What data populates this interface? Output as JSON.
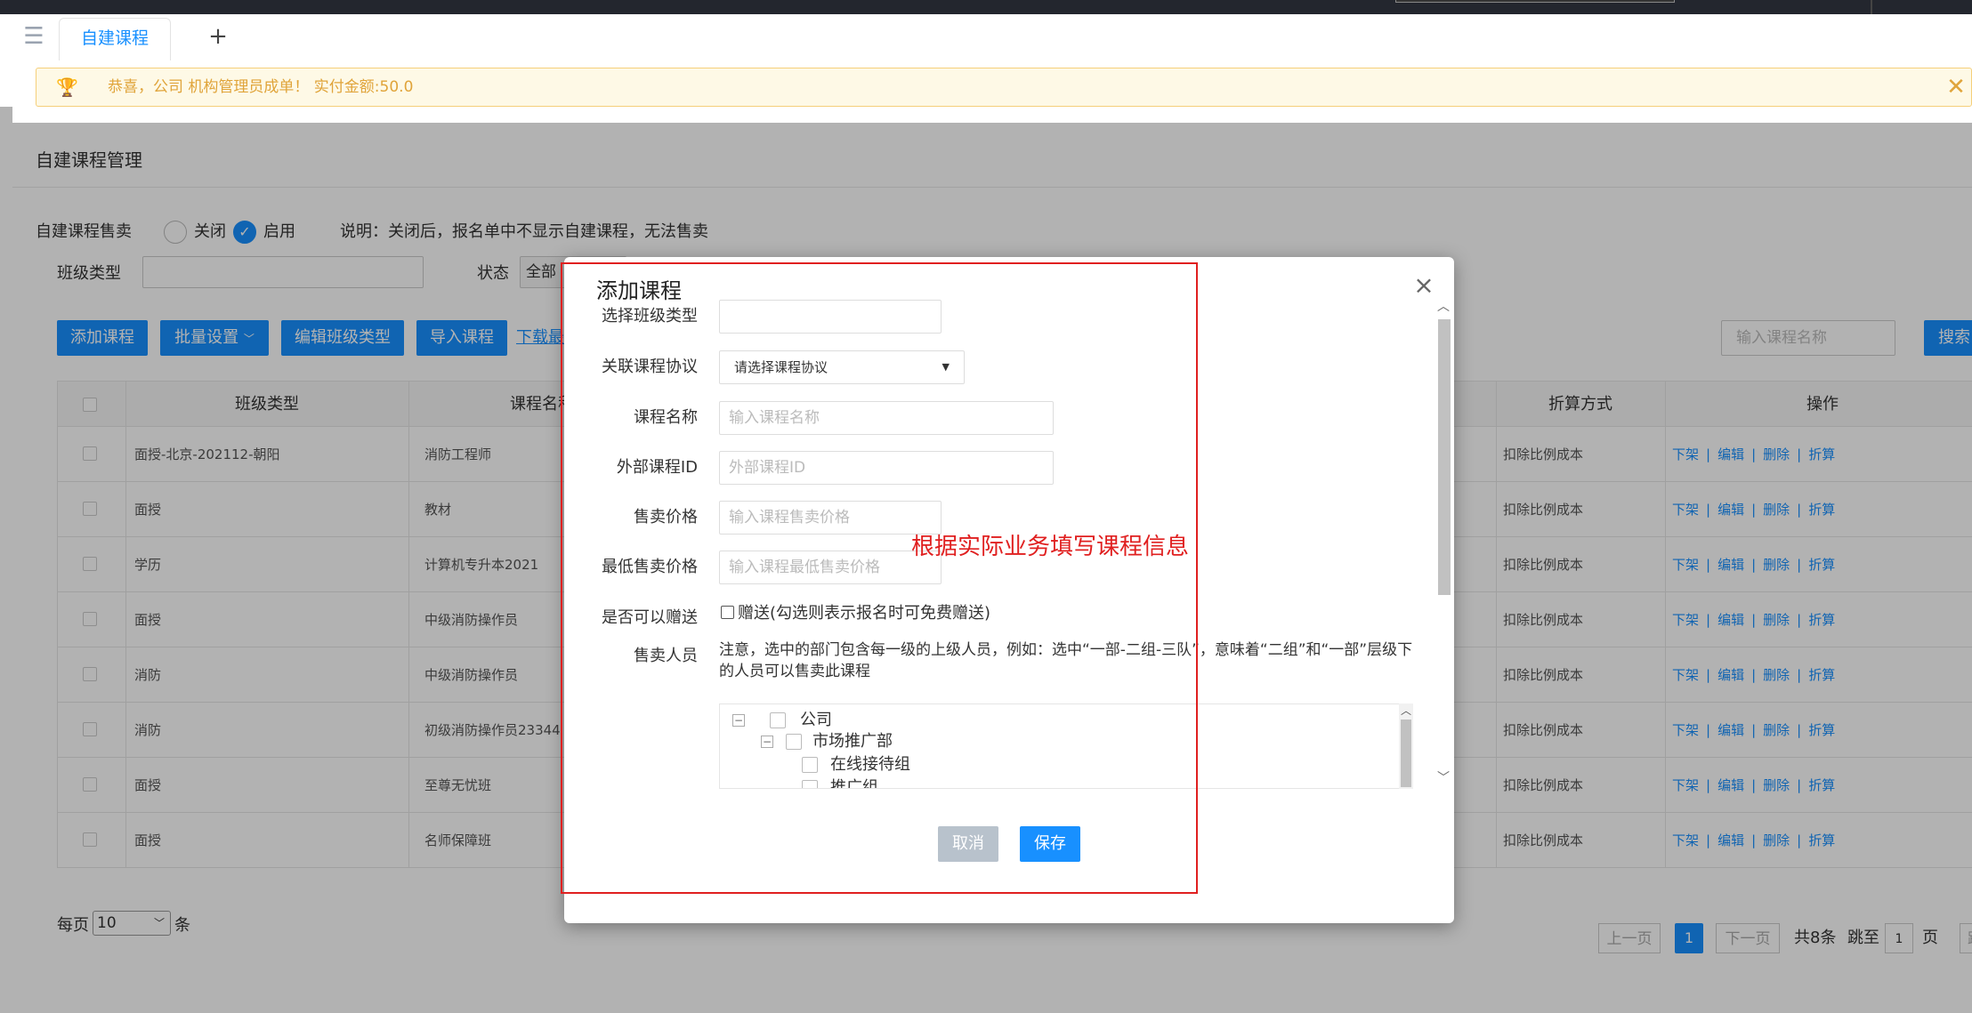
{
  "tabbar": {
    "toggle_icon": "menu-fold-icon",
    "active_tab": "自建课程",
    "add_tab_symbol": "+"
  },
  "notice": {
    "icon": "trophy-icon",
    "message": "恭喜，公司 机构管理员成单！  实付金额:50.0",
    "close_symbol": "✕"
  },
  "page": {
    "title": "自建课程管理",
    "sale": {
      "label": "自建课程售卖",
      "off_label": "关闭",
      "on_label": "启用",
      "selected": "启用",
      "note": "说明：关闭后，报名单中不显示自建课程，无法售卖"
    },
    "filters": {
      "class_type_label": "班级类型",
      "class_type_value": "",
      "status_label": "状态",
      "status_value": "全部"
    },
    "toolbar": {
      "add_course": "添加课程",
      "batch_settings": "批量设置",
      "edit_class_type": "编辑班级类型",
      "import_course": "导入课程",
      "download_link": "下载最",
      "search_placeholder": "输入课程名称",
      "search_button": "搜索"
    },
    "table": {
      "headers": {
        "class_type": "班级类型",
        "course_name": "课程名称",
        "discount_method": "折算方式",
        "actions": "操作"
      },
      "rows": [
        {
          "class_type": "面授-北京-202112-朝阳",
          "course_name": "消防工程师",
          "discount": "扣除比例成本"
        },
        {
          "class_type": "面授",
          "course_name": "教材",
          "discount": "扣除比例成本"
        },
        {
          "class_type": "学历",
          "course_name": "计算机专升本2021",
          "discount": "扣除比例成本"
        },
        {
          "class_type": "面授",
          "course_name": "中级消防操作员",
          "discount": "扣除比例成本"
        },
        {
          "class_type": "消防",
          "course_name": "中级消防操作员",
          "discount": "扣除比例成本"
        },
        {
          "class_type": "消防",
          "course_name": "初级消防操作员23344",
          "discount": "扣除比例成本"
        },
        {
          "class_type": "面授",
          "course_name": "至尊无忧班",
          "discount": "扣除比例成本"
        },
        {
          "class_type": "面授",
          "course_name": "名师保障班",
          "discount": "扣除比例成本"
        }
      ],
      "ops": {
        "off_shelf": "下架",
        "edit": "编辑",
        "delete": "删除",
        "discount": "折算",
        "sep": "|"
      }
    },
    "pagination": {
      "per_page_label": "每页",
      "per_page_value": "10",
      "per_page_unit": "条",
      "prev": "上一页",
      "current": "1",
      "next": "下一页",
      "total": "共8条",
      "jump_label": "跳至",
      "jump_value": "1",
      "page_unit": "页",
      "jump_button": "跳"
    }
  },
  "modal": {
    "title": "添加课程",
    "close_symbol": "×",
    "fields": {
      "class_type": {
        "label": "选择班级类型",
        "value": ""
      },
      "agreement": {
        "label": "关联课程协议",
        "value": "请选择课程协议"
      },
      "course_name": {
        "label": "课程名称",
        "placeholder": "输入课程名称"
      },
      "external_id": {
        "label": "外部课程ID",
        "placeholder": "外部课程ID"
      },
      "price": {
        "label": "售卖价格",
        "placeholder": "输入课程售卖价格"
      },
      "min_price": {
        "label": "最低售卖价格",
        "placeholder": "输入课程最低售卖价格"
      },
      "gift": {
        "label": "是否可以赠送",
        "checkbox_text": "赠送(勾选则表示报名时可免费赠送)"
      },
      "sales_staff": {
        "label": "售卖人员",
        "note": "注意，选中的部门包含每一级的上级人员，例如：选中“一部-二组-三队”，意味着“二组”和“一部”层级下的人员可以售卖此课程"
      }
    },
    "tree": [
      {
        "label": "公司",
        "level": 0,
        "toggle": "−"
      },
      {
        "label": "市场推广部",
        "level": 1,
        "toggle": "−"
      },
      {
        "label": "在线接待组",
        "level": 2,
        "toggle": ""
      },
      {
        "label": "推广组",
        "level": 2,
        "toggle": ""
      }
    ],
    "cancel": "取消",
    "save": "保存"
  },
  "annotation": "根据实际业务填写课程信息",
  "colors": {
    "primary": "#1890ff",
    "annotation": "#e02020",
    "notice_text": "#e0a43a",
    "notice_bg": "#fef9e6"
  }
}
